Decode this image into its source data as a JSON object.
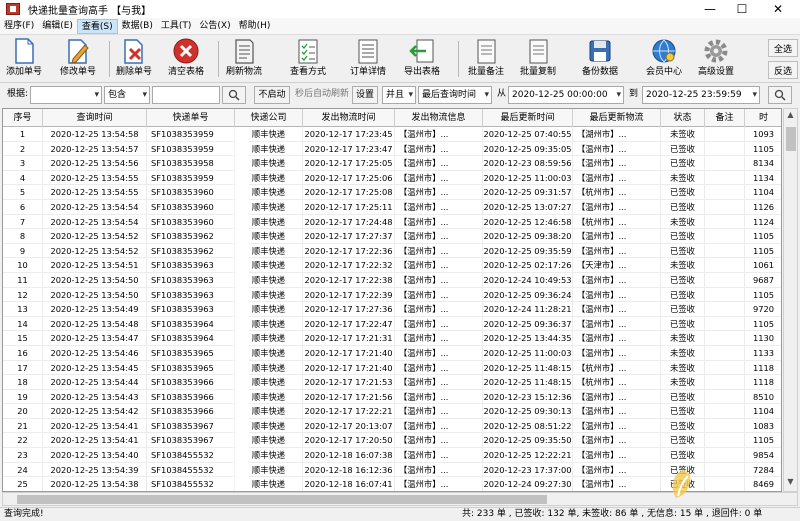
{
  "window": {
    "title": "快递批量查询高手 【与我】",
    "min": "—",
    "max": "☐",
    "close": "✕"
  },
  "menu": [
    {
      "label": "程序(F)"
    },
    {
      "label": "编辑(E)"
    },
    {
      "label": "查看(S)"
    },
    {
      "label": "数据(B)"
    },
    {
      "label": "工具(T)"
    },
    {
      "label": "公告(X)"
    },
    {
      "label": "帮助(H)"
    }
  ],
  "toolbar": {
    "add": "添加单号",
    "edit": "修改单号",
    "delete": "删除单号",
    "clear": "清空表格",
    "refresh": "刷新物流",
    "view_mode": "查看方式",
    "order_detail": "订单详情",
    "export": "导出表格",
    "batch_note": "批量备注",
    "batch_copy": "批量复制",
    "backup": "备份数据",
    "member": "会员中心",
    "advanced": "高级设置",
    "select_all": "全选",
    "invert": "反选"
  },
  "icons": {
    "add": "document-icon",
    "edit": "pencil-icon",
    "delete": "delete-doc-icon",
    "clear": "no-entry-icon",
    "refresh": "document-lines-icon",
    "view": "checklist-icon",
    "detail": "list-icon",
    "export": "arrow-left-doc-icon",
    "note": "doc-icon",
    "copy": "doc-icon",
    "backup": "floppy-icon",
    "member": "globe-icon",
    "advanced": "gear-icon"
  },
  "search": {
    "by_label": "根据:",
    "by_value": "",
    "match_value": "包含",
    "keyword": "",
    "autorefresh_btn": "不启动",
    "autorefresh_text": "秒后自动刷新",
    "settings_btn": "设置",
    "logic_value": "并且",
    "time_field": "最后查询时间",
    "from_label": "从",
    "from_value": "2020-12-25 00:00:00",
    "to_label": "到",
    "to_value": "2020-12-25 23:59:59"
  },
  "table": {
    "columns": [
      "序号",
      "查询时间",
      "快递单号",
      "快递公司",
      "发出物流时间",
      "发出物流信息",
      "最后更新时间",
      "最后更新物流",
      "状态",
      "备注",
      "时"
    ],
    "rows": [
      [
        "1",
        "2020-12-25 13:54:58",
        "SF1038353959",
        "顺丰快递",
        "2020-12-17 17:23:45",
        "【温州市】...",
        "2020-12-25 07:40:55",
        "【湖州市】...",
        "未签收",
        "",
        "1093"
      ],
      [
        "2",
        "2020-12-25 13:54:57",
        "SF1038353959",
        "顺丰快递",
        "2020-12-17 17:23:47",
        "【温州市】...",
        "2020-12-25 09:35:05",
        "【温州市】...",
        "已签收",
        "",
        "1105"
      ],
      [
        "3",
        "2020-12-25 13:54:56",
        "SF1038353958",
        "顺丰快递",
        "2020-12-17 17:25:05",
        "【温州市】...",
        "2020-12-23 08:59:56",
        "【温州市】...",
        "已签收",
        "",
        "8134"
      ],
      [
        "4",
        "2020-12-25 13:54:55",
        "SF1038353959",
        "顺丰快递",
        "2020-12-17 17:25:06",
        "【温州市】...",
        "2020-12-25 11:00:03",
        "【温州市】...",
        "未签收",
        "",
        "1134"
      ],
      [
        "5",
        "2020-12-25 13:54:55",
        "SF1038353960",
        "顺丰快递",
        "2020-12-17 17:25:08",
        "【温州市】...",
        "2020-12-25 09:31:57",
        "【杭州市】...",
        "已签收",
        "",
        "1104"
      ],
      [
        "6",
        "2020-12-25 13:54:54",
        "SF1038353960",
        "顺丰快递",
        "2020-12-17 17:25:11",
        "【温州市】...",
        "2020-12-25 13:07:27",
        "【温州市】...",
        "已签收",
        "",
        "1126"
      ],
      [
        "7",
        "2020-12-25 13:54:54",
        "SF1038353960",
        "顺丰快递",
        "2020-12-17 17:24:48",
        "【温州市】...",
        "2020-12-25 12:46:58",
        "【杭州市】...",
        "未签收",
        "",
        "1124"
      ],
      [
        "8",
        "2020-12-25 13:54:52",
        "SF1038353962",
        "顺丰快递",
        "2020-12-17 17:27:37",
        "【温州市】...",
        "2020-12-25 09:38:20",
        "【温州市】...",
        "已签收",
        "",
        "1105"
      ],
      [
        "9",
        "2020-12-25 13:54:52",
        "SF1038353962",
        "顺丰快递",
        "2020-12-17 17:22:36",
        "【温州市】...",
        "2020-12-25 09:35:59",
        "【温州市】...",
        "已签收",
        "",
        "1105"
      ],
      [
        "10",
        "2020-12-25 13:54:51",
        "SF1038353963",
        "顺丰快递",
        "2020-12-17 17:22:32",
        "【温州市】...",
        "2020-12-25 02:17:26",
        "【天津市】...",
        "未签收",
        "",
        "1061"
      ],
      [
        "11",
        "2020-12-25 13:54:50",
        "SF1038353963",
        "顺丰快递",
        "2020-12-17 17:22:38",
        "【温州市】...",
        "2020-12-24 10:49:53",
        "【温州市】...",
        "已签收",
        "",
        "9687"
      ],
      [
        "12",
        "2020-12-25 13:54:50",
        "SF1038353963",
        "顺丰快递",
        "2020-12-17 17:22:39",
        "【温州市】...",
        "2020-12-25 09:36:24",
        "【温州市】...",
        "已签收",
        "",
        "1105"
      ],
      [
        "13",
        "2020-12-25 13:54:49",
        "SF1038353963",
        "顺丰快递",
        "2020-12-17 17:27:36",
        "【温州市】...",
        "2020-12-24 11:28:21",
        "【温州市】...",
        "已签收",
        "",
        "9720"
      ],
      [
        "14",
        "2020-12-25 13:54:48",
        "SF1038353964",
        "顺丰快递",
        "2020-12-17 17:22:47",
        "【温州市】...",
        "2020-12-25 09:36:37",
        "【温州市】...",
        "已签收",
        "",
        "1105"
      ],
      [
        "15",
        "2020-12-25 13:54:47",
        "SF1038353964",
        "顺丰快递",
        "2020-12-17 17:21:31",
        "【温州市】...",
        "2020-12-25 13:44:35",
        "【温州市】...",
        "未签收",
        "",
        "1130"
      ],
      [
        "16",
        "2020-12-25 13:54:46",
        "SF1038353965",
        "顺丰快递",
        "2020-12-17 17:21:40",
        "【温州市】...",
        "2020-12-25 11:00:03",
        "【温州市】...",
        "未签收",
        "",
        "1133"
      ],
      [
        "17",
        "2020-12-25 13:54:45",
        "SF1038353965",
        "顺丰快递",
        "2020-12-17 17:21:40",
        "【温州市】...",
        "2020-12-25 11:48:15",
        "【杭州市】...",
        "未签收",
        "",
        "1118"
      ],
      [
        "18",
        "2020-12-25 13:54:44",
        "SF1038353966",
        "顺丰快递",
        "2020-12-17 17:21:53",
        "【温州市】...",
        "2020-12-25 11:48:15",
        "【杭州市】...",
        "未签收",
        "",
        "1118"
      ],
      [
        "19",
        "2020-12-25 13:54:43",
        "SF1038353966",
        "顺丰快递",
        "2020-12-17 17:21:56",
        "【温州市】...",
        "2020-12-23 15:12:36",
        "【温州市】...",
        "已签收",
        "",
        "8510"
      ],
      [
        "20",
        "2020-12-25 13:54:42",
        "SF1038353966",
        "顺丰快递",
        "2020-12-17 17:22:21",
        "【温州市】...",
        "2020-12-25 09:30:13",
        "【温州市】...",
        "已签收",
        "",
        "1104"
      ],
      [
        "21",
        "2020-12-25 13:54:41",
        "SF1038353967",
        "顺丰快递",
        "2020-12-17 20:13:07",
        "【温州市】...",
        "2020-12-25 08:51:22",
        "【温州市】...",
        "已签收",
        "",
        "1083"
      ],
      [
        "22",
        "2020-12-25 13:54:41",
        "SF1038353967",
        "顺丰快递",
        "2020-12-17 17:20:50",
        "【温州市】...",
        "2020-12-25 09:35:50",
        "【温州市】...",
        "已签收",
        "",
        "1105"
      ],
      [
        "23",
        "2020-12-25 13:54:40",
        "SF1038455532",
        "顺丰快递",
        "2020-12-18 16:07:38",
        "【温州市】...",
        "2020-12-25 12:22:21",
        "【温州市】...",
        "已签收",
        "",
        "9854"
      ],
      [
        "24",
        "2020-12-25 13:54:39",
        "SF1038455532",
        "顺丰快递",
        "2020-12-18 16:12:36",
        "【温州市】...",
        "2020-12-23 17:37:00",
        "【温州市】...",
        "已签收",
        "",
        "7284"
      ],
      [
        "25",
        "2020-12-25 13:54:38",
        "SF1038455532",
        "顺丰快递",
        "2020-12-18 16:07:41",
        "【温州市】...",
        "2020-12-24 09:27:30",
        "【温州市】...",
        "已签收",
        "",
        "8469"
      ]
    ]
  },
  "status": {
    "left": "查询完成!",
    "summary": "共: 233 单 , 已签收: 132 单, 未签收: 86 单 , 无信息: 15 单 , 退回件: 0 单"
  },
  "colors": {
    "accent": "#1f6fc5",
    "delete": "#d0312d",
    "gear": "#8a8a8a"
  }
}
